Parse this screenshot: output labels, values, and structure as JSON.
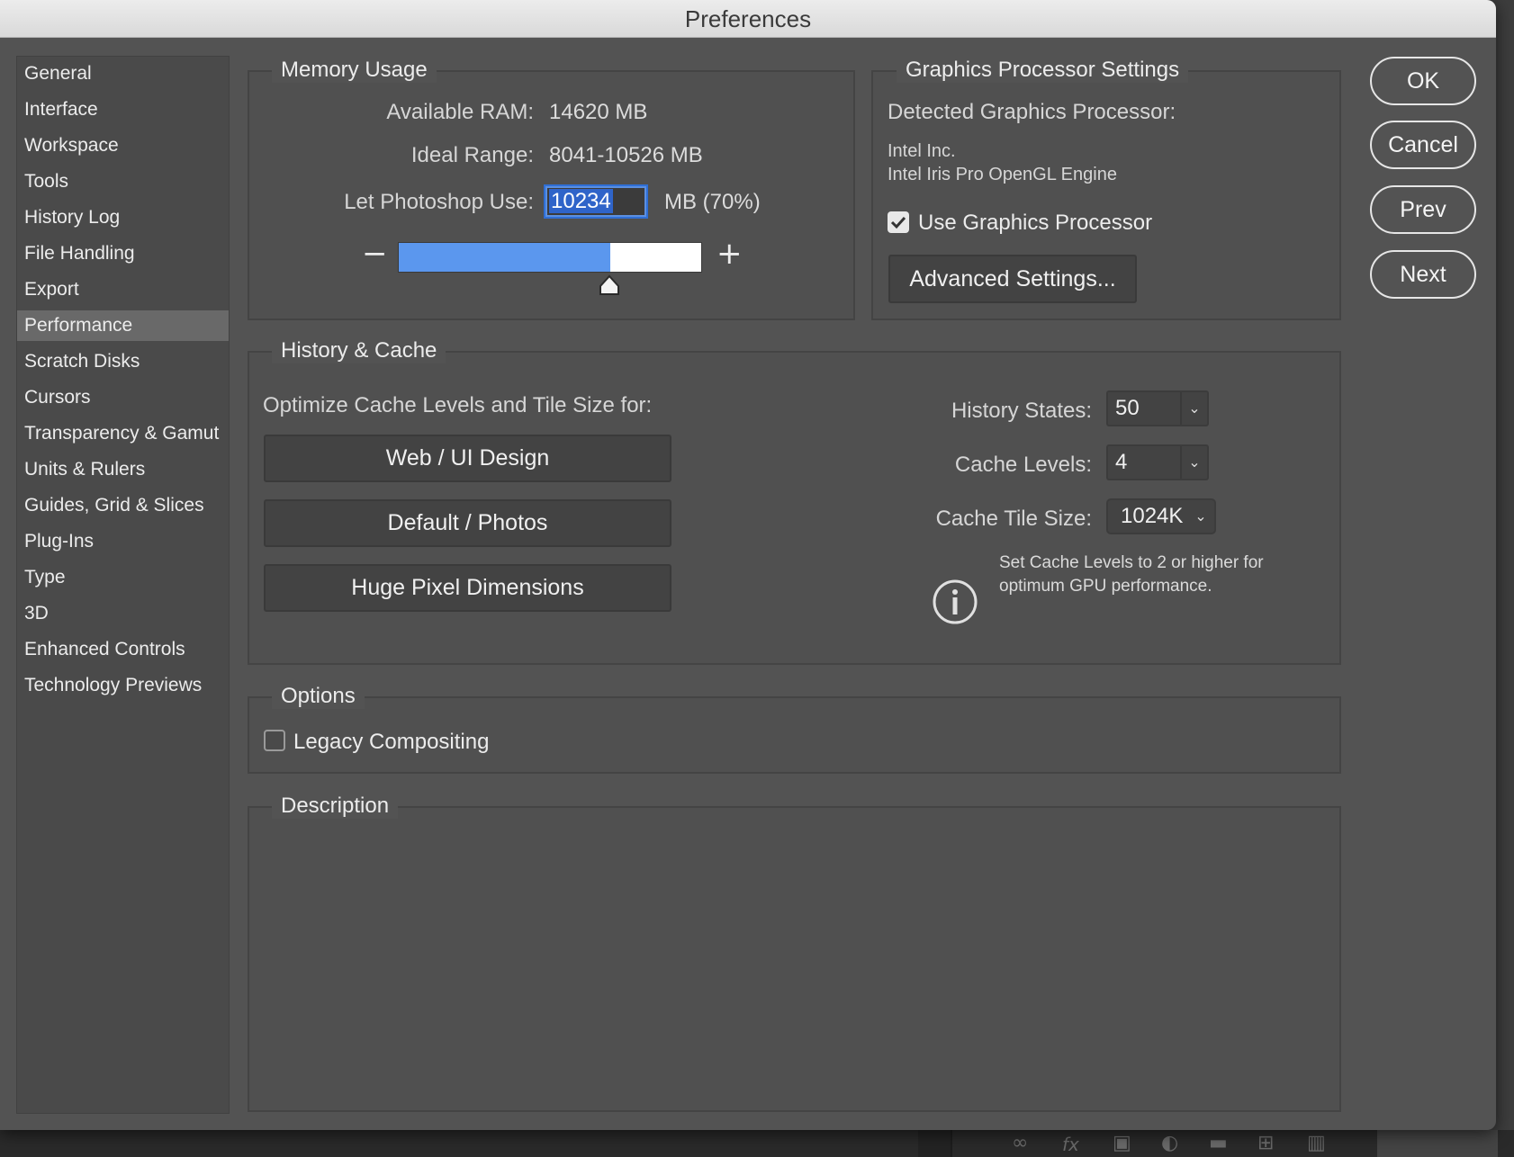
{
  "window": {
    "title": "Preferences"
  },
  "sidebar": {
    "items": [
      {
        "label": "General"
      },
      {
        "label": "Interface"
      },
      {
        "label": "Workspace"
      },
      {
        "label": "Tools"
      },
      {
        "label": "History Log"
      },
      {
        "label": "File Handling"
      },
      {
        "label": "Export"
      },
      {
        "label": "Performance",
        "selected": true
      },
      {
        "label": "Scratch Disks"
      },
      {
        "label": "Cursors"
      },
      {
        "label": "Transparency & Gamut"
      },
      {
        "label": "Units & Rulers"
      },
      {
        "label": "Guides, Grid & Slices"
      },
      {
        "label": "Plug-Ins"
      },
      {
        "label": "Type"
      },
      {
        "label": "3D"
      },
      {
        "label": "Enhanced Controls"
      },
      {
        "label": "Technology Previews"
      }
    ]
  },
  "memory": {
    "title": "Memory Usage",
    "available_label": "Available RAM:",
    "available_value": "14620 MB",
    "ideal_label": "Ideal Range:",
    "ideal_value": "8041-10526 MB",
    "use_label": "Let Photoshop Use:",
    "use_value": "10234",
    "use_suffix": "MB (70%)",
    "minus": "−",
    "plus": "+",
    "slider_fraction": 0.7
  },
  "gpu": {
    "title": "Graphics Processor Settings",
    "detected_label": "Detected Graphics Processor:",
    "vendor": "Intel Inc.",
    "engine": "Intel Iris Pro OpenGL Engine",
    "use_gpu_label": "Use Graphics Processor",
    "use_gpu_checked": true,
    "advanced_button": "Advanced Settings..."
  },
  "actions": {
    "ok": "OK",
    "cancel": "Cancel",
    "prev": "Prev",
    "next": "Next"
  },
  "history_cache": {
    "title": "History & Cache",
    "optimize_label": "Optimize Cache Levels and Tile Size for:",
    "preset_web": "Web / UI Design",
    "preset_default": "Default / Photos",
    "preset_huge": "Huge Pixel Dimensions",
    "history_states_label": "History States:",
    "history_states_value": "50",
    "cache_levels_label": "Cache Levels:",
    "cache_levels_value": "4",
    "tile_size_label": "Cache Tile Size:",
    "tile_size_value": "1024K",
    "note_line1": "Set Cache Levels to 2 or higher for",
    "note_line2": "optimum GPU performance.",
    "info_icon": "info-icon"
  },
  "options": {
    "title": "Options",
    "legacy_label": "Legacy Compositing",
    "legacy_checked": false
  },
  "description": {
    "title": "Description",
    "text": ""
  },
  "colors": {
    "accent": "#2f6fd6",
    "slider_fill": "#5b97ee",
    "dialog_bg": "#535353"
  }
}
